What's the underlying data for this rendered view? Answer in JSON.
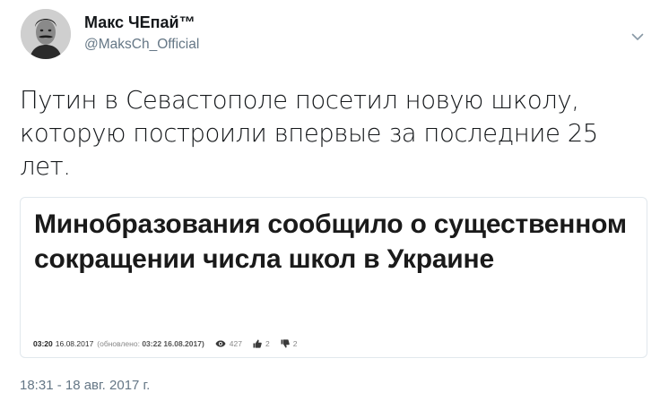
{
  "tweet": {
    "user": {
      "name": "Макс ЧЕпай™",
      "handle": "@MaksCh_Official"
    },
    "text": "Путин в Севастополе посетил новую школу, которую построили впервые за последние 25 лет.",
    "timestamp": "18:31 - 18 авг. 2017 г."
  },
  "embed": {
    "headline": "Минобразования сообщило о существенном сокращении числа школ в Украине",
    "time": "03:20",
    "date": "16.08.2017",
    "updated_prefix": "(обновлено:",
    "updated_value": "03:22 16.08.2017)",
    "views": "427",
    "likes": "2",
    "dislikes": "2"
  },
  "icons": {
    "menu": "chevron-down-icon",
    "views": "eye-icon",
    "likes": "thumbs-up-icon",
    "dislikes": "thumbs-down-icon"
  },
  "colors": {
    "secondary_text": "#657786",
    "card_border": "#e1e8ed"
  }
}
